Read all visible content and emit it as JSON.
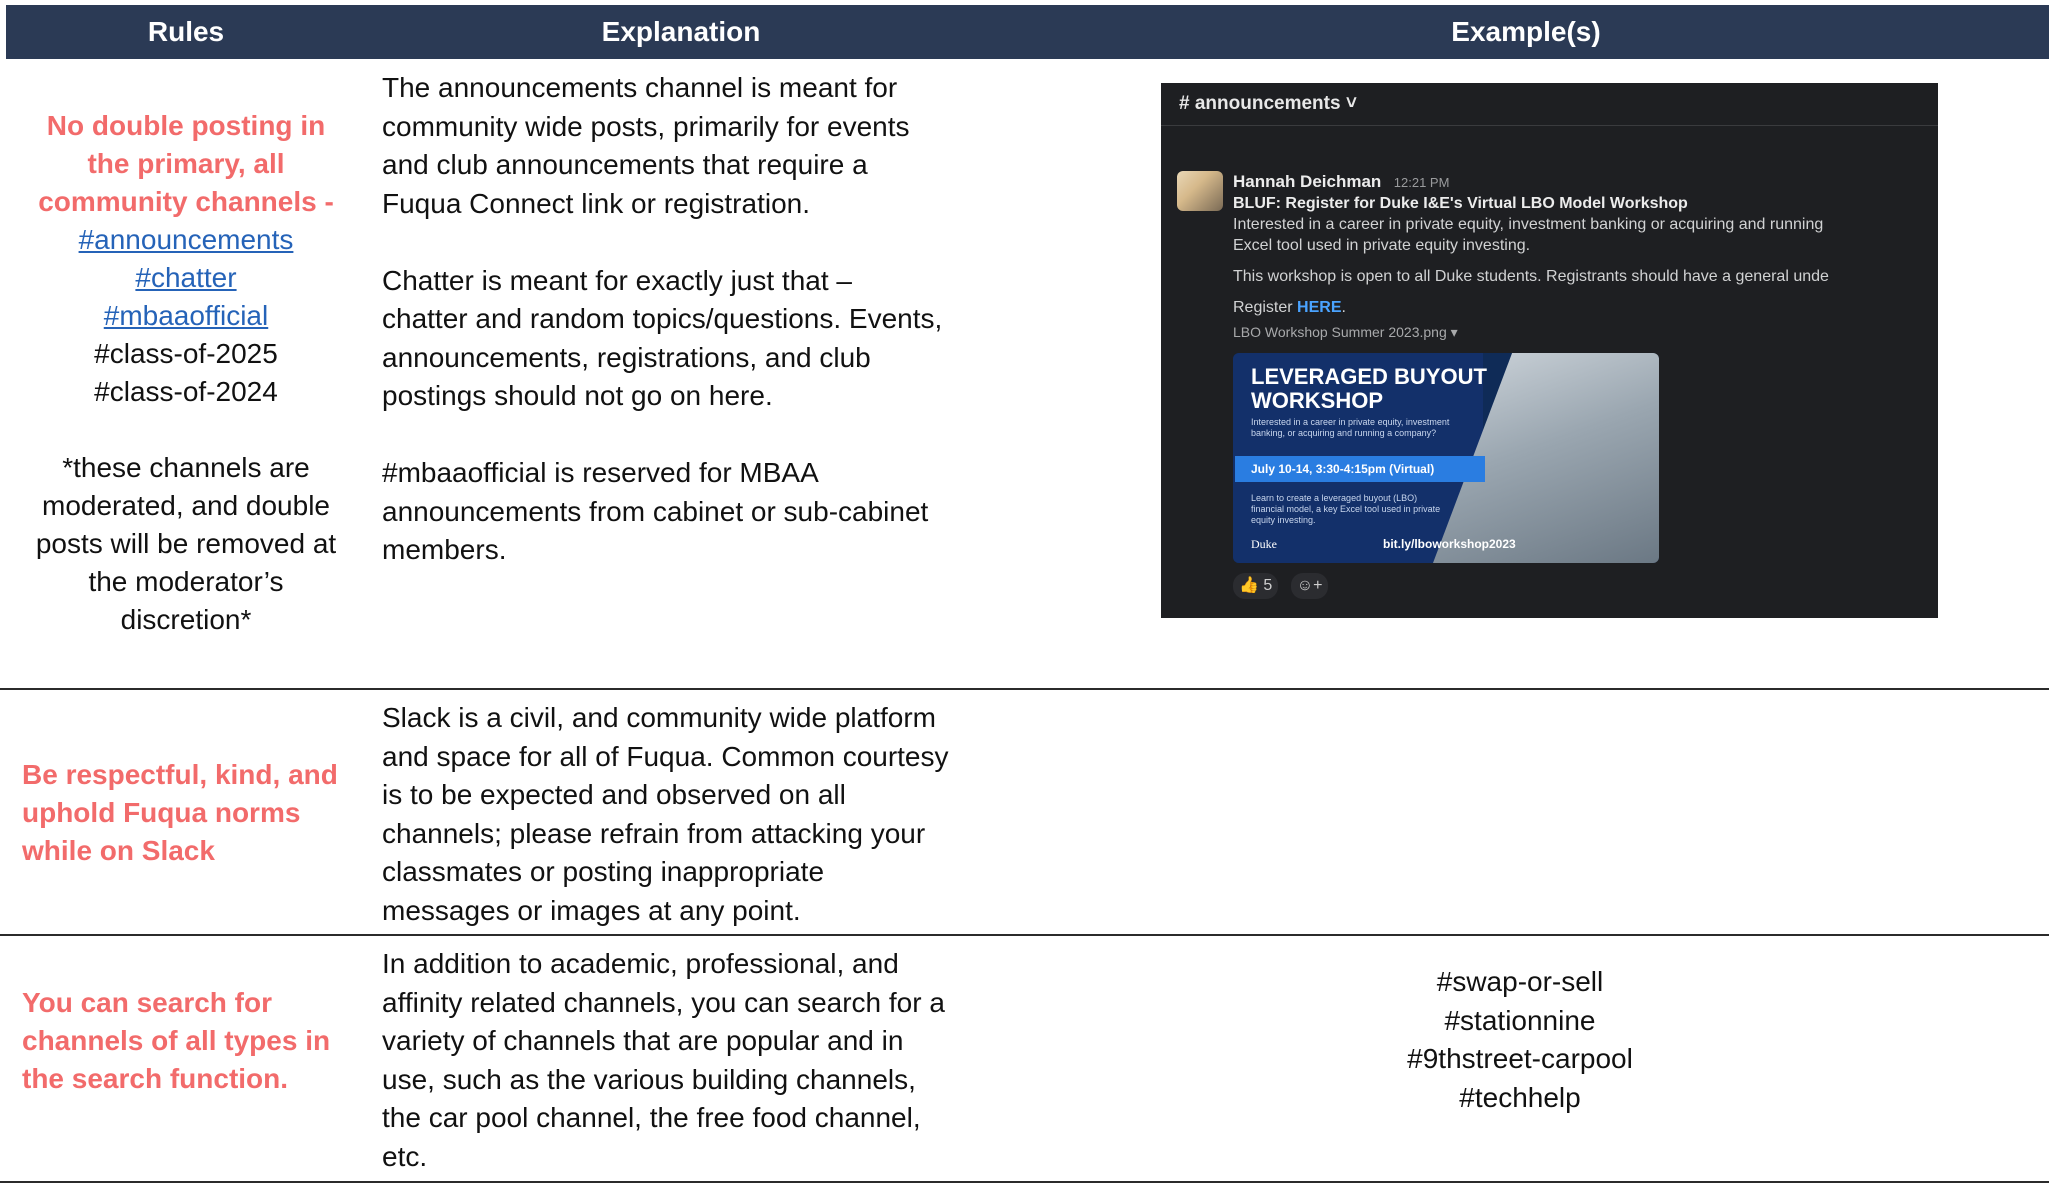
{
  "header": {
    "rules": "Rules",
    "explanation": "Explanation",
    "examples": "Example(s)"
  },
  "row1": {
    "rule_lines": [
      "No double posting in",
      "the primary, all",
      "community channels -"
    ],
    "channels_linked": [
      "#announcements",
      "#chatter",
      "#mbaaofficial"
    ],
    "channels_plain": [
      "#class-of-2025",
      "#class-of-2024"
    ],
    "note_lines": [
      "*these channels are",
      "moderated, and double",
      "posts will be removed at",
      "the moderator’s",
      "discretion*"
    ],
    "explanations": [
      [
        "The announcements channel is meant for",
        "community wide posts, primarily for events",
        "and club announcements that require a",
        "Fuqua Connect link or registration."
      ],
      [
        "Chatter is meant for exactly just that –",
        "chatter and random topics/questions. Events,",
        "announcements, registrations, and club",
        "postings should not go on here."
      ],
      [
        "#mbaaofficial is reserved for MBAA",
        "announcements from cabinet or sub-cabinet",
        "members."
      ]
    ]
  },
  "slack": {
    "channel": "# announcements ˅",
    "author": "Hannah Deichman",
    "time": "12:21 PM",
    "subject": "BLUF: Register for Duke I&E's  Virtual LBO Model Workshop",
    "line1": "Interested in a career in private equity, investment banking or acquiring and running",
    "line2": "Excel tool used in private equity investing.",
    "line3": "This workshop is open to all Duke students. Registrants should have a general unde",
    "register_prefix": "Register ",
    "register_link": "HERE",
    "register_suffix": ".",
    "file": "LBO Workshop Summer 2023.png  ▾",
    "banner": {
      "title_1": "LEVERAGED BUYOUT",
      "title_2": "WORKSHOP",
      "sub": "Interested in a career in private equity, investment banking, or acquiring and running a company?",
      "date": "July 10-14, 3:30-4:15pm (Virtual)",
      "learn": "Learn to create a leveraged buyout (LBO) financial model, a key Excel tool used in private equity investing.",
      "duke": "Duke",
      "url": "bit.ly/lboworkshop2023"
    },
    "reaction_count": "5"
  },
  "row2": {
    "rule_lines": [
      "Be respectful, kind, and",
      "uphold Fuqua norms",
      "while on Slack"
    ],
    "explanation": [
      "Slack is a civil, and community wide platform",
      "and space for all of Fuqua. Common courtesy",
      "is to be expected and observed on all",
      "channels; please refrain from attacking your",
      "classmates or posting inappropriate",
      "messages or images at any point."
    ]
  },
  "row3": {
    "rule_lines": [
      "You can search for",
      "channels of all types in",
      "the search function."
    ],
    "explanation": [
      "In addition to academic, professional, and",
      "affinity related channels, you can search for a",
      "variety of channels that are popular and in",
      "use, such as the various building channels,",
      "the car pool channel, the free food channel,",
      "etc."
    ],
    "examples": [
      "#swap-or-sell",
      "#stationnine",
      "#9thstreet-carpool",
      "#techhelp"
    ]
  }
}
